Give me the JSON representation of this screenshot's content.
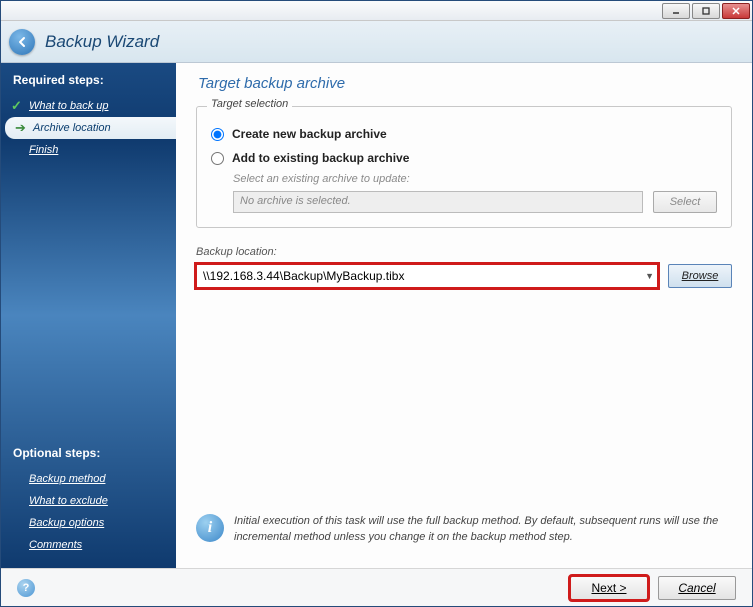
{
  "window": {
    "title": "Backup Wizard"
  },
  "sidebar": {
    "required_heading": "Required steps:",
    "optional_heading": "Optional steps:",
    "required": [
      {
        "label": "What to back up",
        "state": "done"
      },
      {
        "label": "Archive location",
        "state": "active"
      },
      {
        "label": "Finish",
        "state": "pending"
      }
    ],
    "optional": [
      {
        "label": "Backup method"
      },
      {
        "label": "What to exclude"
      },
      {
        "label": "Backup options"
      },
      {
        "label": "Comments"
      }
    ]
  },
  "main": {
    "title": "Target backup archive",
    "target_selection": {
      "legend": "Target selection",
      "create_label": "Create new backup archive",
      "add_label": "Add to existing backup archive",
      "select_hint": "Select an existing archive to update:",
      "no_archive": "No archive is selected.",
      "select_btn": "Select"
    },
    "location": {
      "label": "Backup location:",
      "value": "\\\\192.168.3.44\\Backup\\MyBackup.tibx",
      "browse": "Browse"
    },
    "info": "Initial execution of this task will use the full backup method. By default, subsequent runs will use the incremental method unless you change it on the backup method step."
  },
  "footer": {
    "next": "Next >",
    "cancel": "Cancel"
  }
}
